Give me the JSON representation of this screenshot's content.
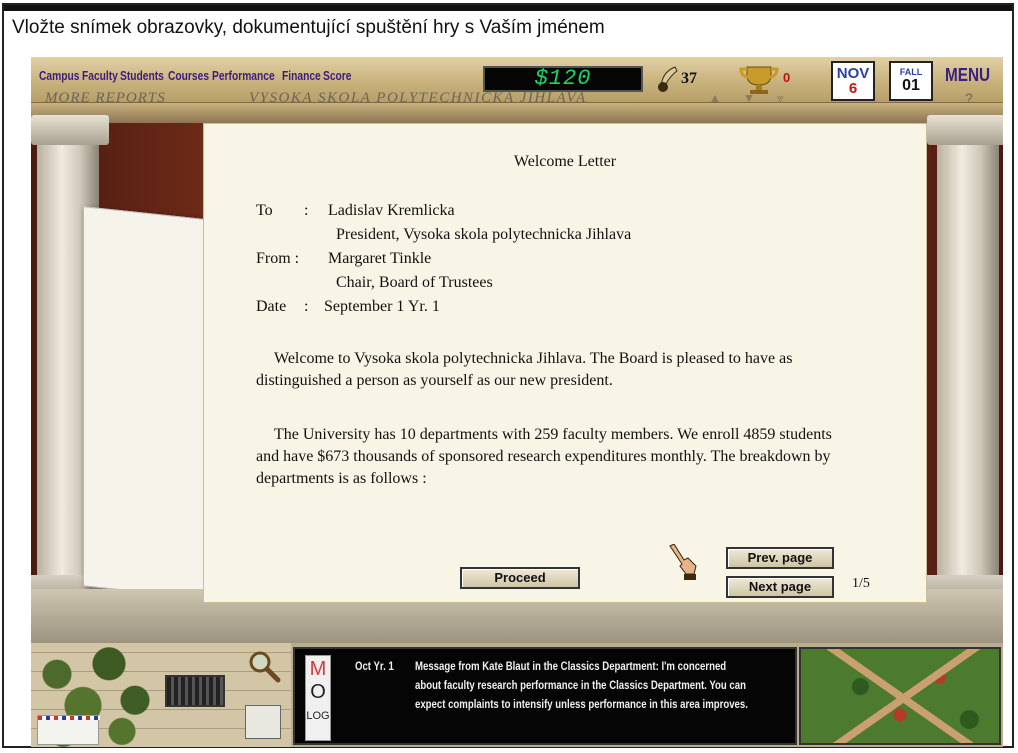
{
  "caption": "Vložte snímek obrazovky, dokumentující spuštění hry s Vaším jménem",
  "menubar": {
    "items": [
      "Campus",
      "Faculty",
      "Students",
      "Courses",
      "Performance",
      "Finance",
      "Score"
    ],
    "money": "$120",
    "quill_count": "37",
    "trophy_count": "0",
    "calendar_month": {
      "top": "NOV",
      "bottom": "6"
    },
    "calendar_term": {
      "top": "FALL",
      "bottom": "01"
    },
    "menu_label": "MENU",
    "more_reports": "MORE REPORTS",
    "college_name": "VYSOKA SKOLA POLYTECHNICKA JIHLAVA",
    "help": "?"
  },
  "letter": {
    "title": "Welcome Letter",
    "to_label": "To",
    "to_sep": ":",
    "to_name": "Ladislav Kremlicka",
    "to_title": "President, Vysoka skola polytechnicka Jihlava",
    "from_label": "From :",
    "from_name": "Margaret Tinkle",
    "from_title": "Chair, Board of Trustees",
    "date_label": "Date",
    "date_sep": ":",
    "date_value": "September 1 Yr. 1",
    "paragraph1": "Welcome to Vysoka skola polytechnicka Jihlava. The Board is pleased to have as distinguished a person as yourself as our new president.",
    "paragraph2": "The University has 10 departments with 259 faculty members. We enroll 4859 students and have $673 thousands of sponsored research expenditures monthly. The breakdown by departments is as follows :",
    "proceed": "Proceed",
    "prev_page": "Prev. page",
    "next_page": "Next page",
    "page_indicator": "1/5"
  },
  "bottom": {
    "mol": [
      "M",
      "O",
      "LOG"
    ],
    "message_date": "Oct Yr. 1",
    "message_text": "Message from Kate Blaut in the Classics Department: I'm concerned about faculty research performance in the Classics Department. You can expect complaints to intensify unless performance in this area improves."
  },
  "colors": {
    "menu_text": "#3b1f7a",
    "money_green": "#19d46a",
    "calendar_red": "#c21515",
    "letter_bg": "#f8f5e6"
  }
}
